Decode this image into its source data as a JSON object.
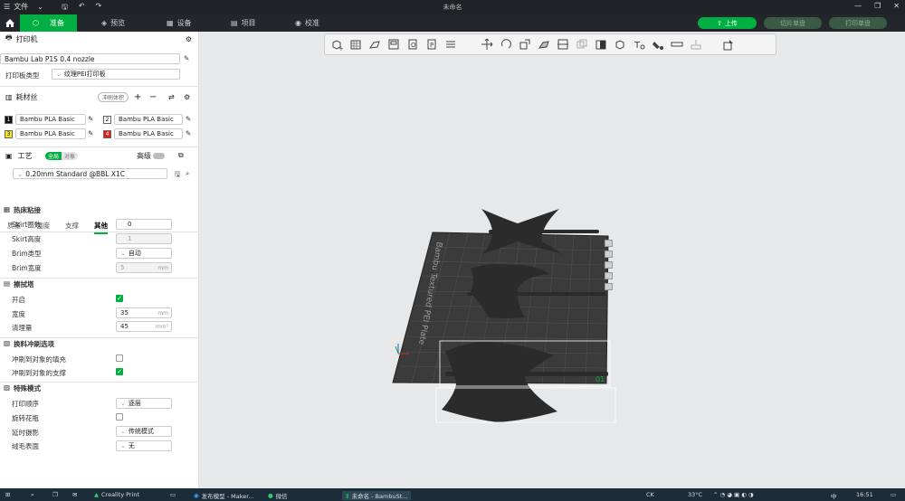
{
  "titlebar": {
    "file_label": "文件",
    "window_title": "未命名"
  },
  "nav": {
    "tabs": [
      {
        "label": "准备"
      },
      {
        "label": "预览"
      },
      {
        "label": "设备"
      },
      {
        "label": "项目"
      },
      {
        "label": "校准"
      }
    ],
    "upload_label": "上传",
    "slice_label": "切片单盘",
    "print_label": "打印单盘"
  },
  "printer": {
    "section_title": "打印机",
    "name": "Bambu Lab P1S 0.4 nozzle",
    "plate_type_label": "打印板类型",
    "plate_type_value": "纹理PEI打印板"
  },
  "filament": {
    "section_title": "耗材丝",
    "flush_label": "冲刷体积",
    "items": [
      {
        "index": "1",
        "name": "Bambu PLA Basic",
        "color": "#111111"
      },
      {
        "index": "2",
        "name": "Bambu PLA Basic",
        "color": "#ffffff"
      },
      {
        "index": "3",
        "name": "Bambu PLA Basic",
        "color": "#f5e51a"
      },
      {
        "index": "4",
        "name": "Bambu PLA Basic",
        "color": "#e0201b"
      }
    ]
  },
  "process": {
    "section_title": "工艺",
    "toggle_global": "全局",
    "toggle_object": "对象",
    "advanced_label": "高级",
    "profile": "0.20mm Standard @BBL X1C",
    "subtabs": [
      "质量",
      "强度",
      "支撑",
      "其他"
    ]
  },
  "settings": {
    "bed_adhesion": {
      "title": "热床粘接",
      "skirt_loops_label": "Skirt圈数",
      "skirt_loops_value": "0",
      "skirt_height_label": "Skirt高度",
      "skirt_height_value": "1",
      "brim_type_label": "Brim类型",
      "brim_type_value": "自动",
      "brim_width_label": "Brim宽度",
      "brim_width_value": "5",
      "brim_width_unit": "mm"
    },
    "prime_tower": {
      "title": "擦拭塔",
      "enable_label": "开启",
      "width_label": "宽度",
      "width_value": "35",
      "width_unit": "mm",
      "volume_label": "清理量",
      "volume_value": "45",
      "volume_unit": "mm³"
    },
    "flush_options": {
      "title": "换料冲刷选项",
      "infill_label": "冲刷到对象的填充",
      "support_label": "冲刷到对象的支撑"
    },
    "special_mode": {
      "title": "特殊模式",
      "print_sequence_label": "打印顺序",
      "print_sequence_value": "逐层",
      "spiral_label": "旋转花瓶",
      "timelapse_label": "延时摄影",
      "timelapse_value": "传统模式",
      "fuzzy_label": "绒毛表面",
      "fuzzy_value": "无"
    }
  },
  "viewport": {
    "plate_text": "Bambu Textured PEI Plate",
    "plate_index": "01"
  },
  "taskbar": {
    "items": [
      "Creality Print",
      "发布模型 - Maker...",
      "微信",
      "未命名 - BambuSt..."
    ],
    "lang": "CK",
    "temperature": "33°C",
    "ime": "中",
    "time": "16:51"
  },
  "colors": {
    "accent": "#00ae42",
    "panel_bg": "#ffffff",
    "viewport_bg": "#e7e8e9",
    "titlebar_bg": "#1f2326"
  }
}
